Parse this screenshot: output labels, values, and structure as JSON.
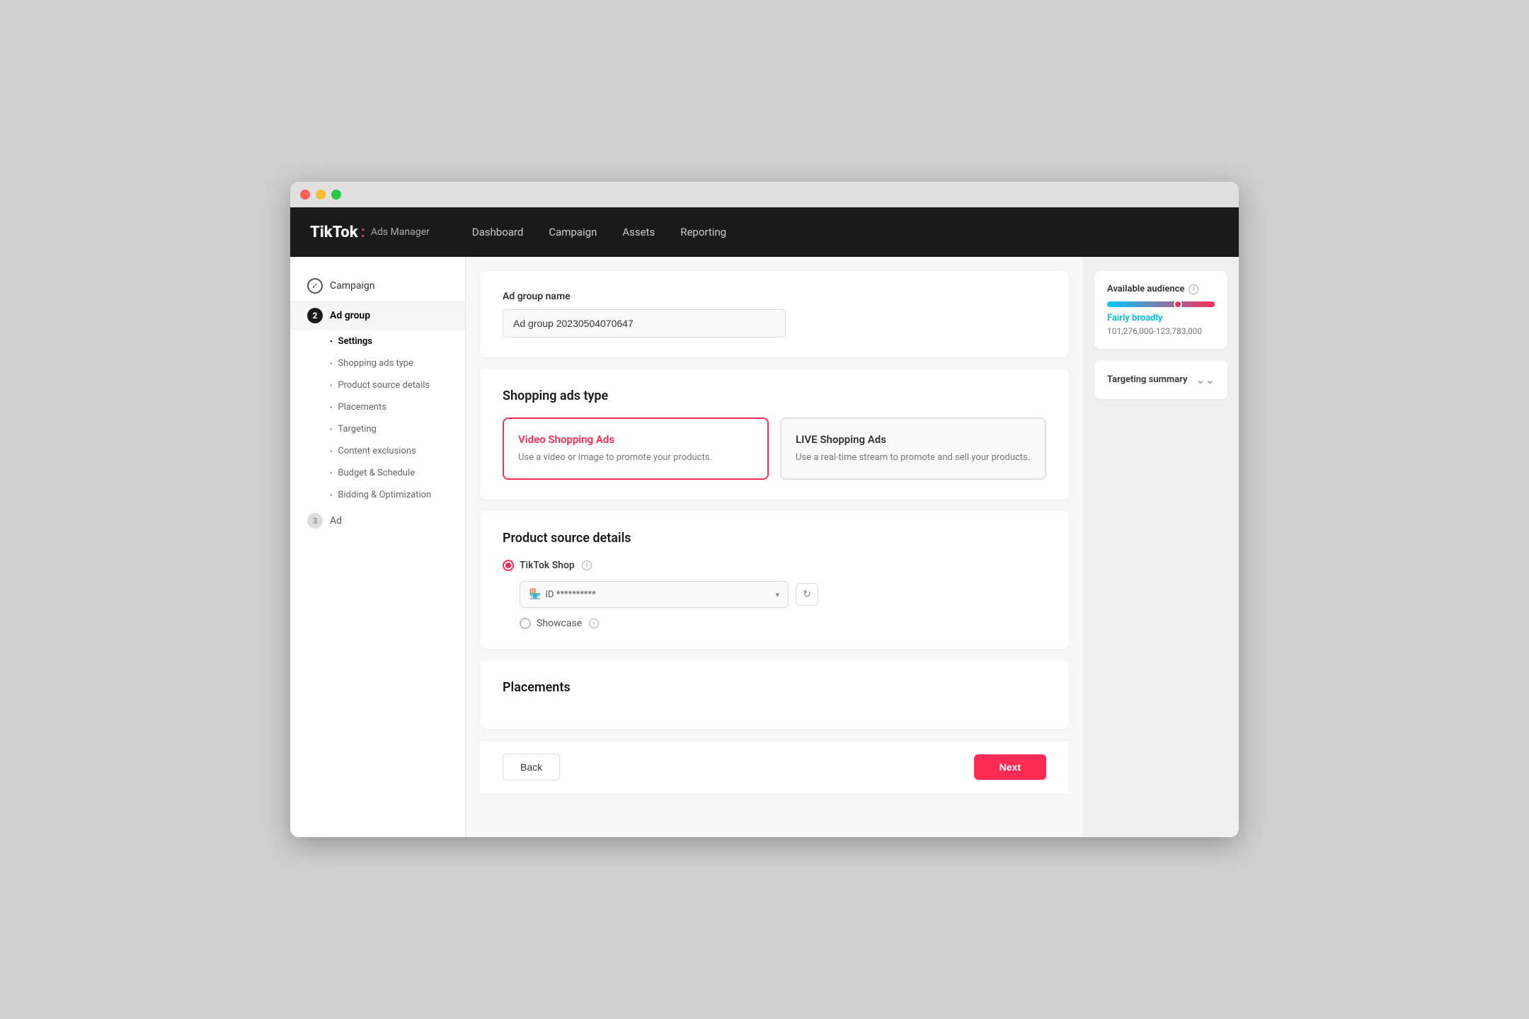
{
  "window": {
    "title": "TikTok Ads Manager"
  },
  "navbar": {
    "logo": "TikTok",
    "logo_dot": ":",
    "logo_sub": "Ads Manager",
    "links": [
      "Dashboard",
      "Campaign",
      "Assets",
      "Reporting"
    ]
  },
  "sidebar": {
    "step1": {
      "label": "Campaign",
      "status": "completed"
    },
    "step2": {
      "number": "2",
      "label": "Ad group"
    },
    "step2_sub": [
      {
        "label": "Settings",
        "active": true
      },
      {
        "label": "Shopping ads type"
      },
      {
        "label": "Product source details"
      },
      {
        "label": "Placements"
      },
      {
        "label": "Targeting"
      },
      {
        "label": "Content exclusions"
      },
      {
        "label": "Budget & Schedule"
      },
      {
        "label": "Bidding & Optimization"
      }
    ],
    "step3": {
      "number": "3",
      "label": "Ad"
    }
  },
  "adgroup_name_section": {
    "label": "Ad group name",
    "value": "Ad group 20230504070647",
    "placeholder": "Ad group 20230504070647"
  },
  "shopping_ads_type": {
    "title": "Shopping ads type",
    "option1": {
      "title": "Video Shopping Ads",
      "desc": "Use a video or image to promote your products.",
      "selected": true
    },
    "option2": {
      "title": "LIVE Shopping Ads",
      "desc": "Use a real-time stream to promote and sell your products.",
      "selected": false
    }
  },
  "product_source": {
    "title": "Product source details",
    "option1": {
      "label": "TikTok Shop",
      "selected": true
    },
    "dropdown": {
      "icon": "🏪",
      "text": "ID  •  •  •  •  •  •  •  •  •  •",
      "placeholder": "ID **********"
    },
    "option2": {
      "label": "Showcase",
      "selected": false
    }
  },
  "placements": {
    "title": "Placements"
  },
  "audience": {
    "title": "Available audience",
    "label": "Fairly broadly",
    "range": "101,276,000-123,783,000"
  },
  "targeting": {
    "title": "Targeting summary"
  },
  "footer": {
    "back_label": "Back",
    "next_label": "Next"
  }
}
